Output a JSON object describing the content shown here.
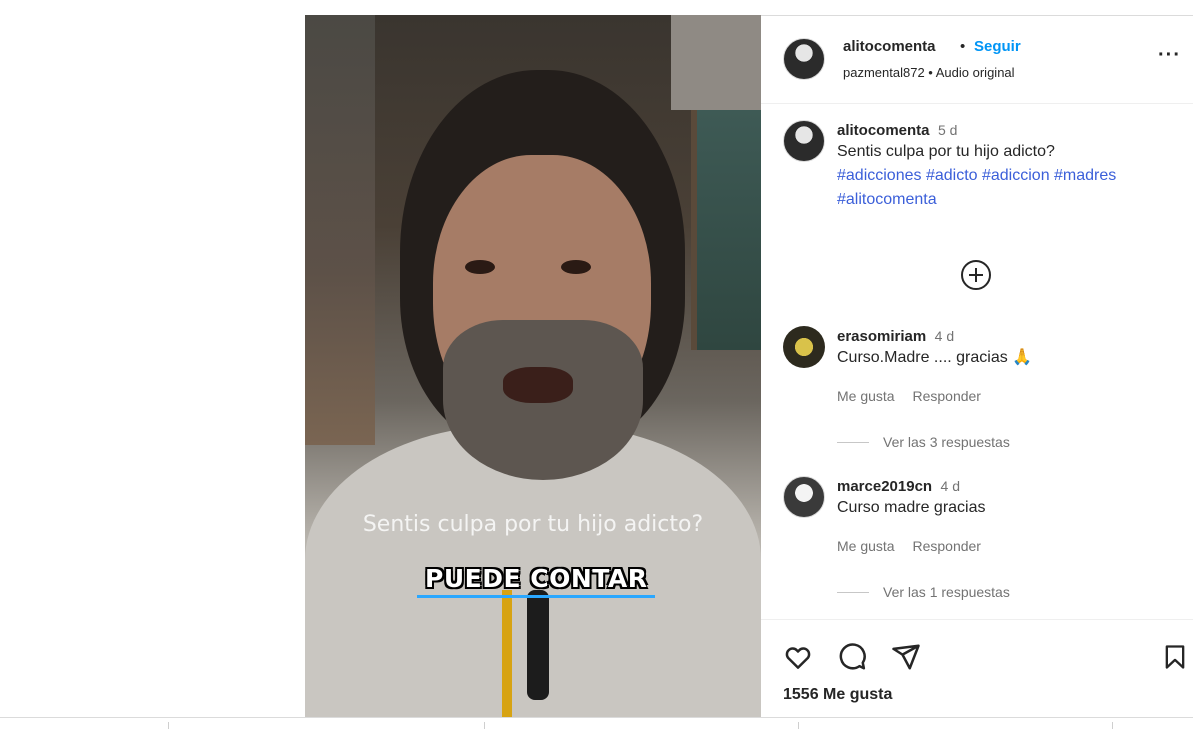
{
  "video": {
    "subtitle_text": "Sentis culpa por tu hijo adicto?",
    "caption_text": "PUEDE CONTAR"
  },
  "header": {
    "username": "alitocomenta",
    "dot": "•",
    "follow_label": "Seguir",
    "sub_user": "pazmental872",
    "sub_audio": "Audio original",
    "more_label": "···"
  },
  "caption_post": {
    "username": "alitocomenta",
    "time": "5 d",
    "text": "Sentis culpa por tu hijo adicto?",
    "hashtags_line1": "#adicciones #adicto #adiccion #madres",
    "hashtags_line2": "#alitocomenta"
  },
  "comments": [
    {
      "username": "erasomiriam",
      "time": "4 d",
      "text": "Curso.Madre .... gracias 🙏",
      "like_label": "Me gusta",
      "reply_label": "Responder",
      "view_replies": "Ver las 3 respuestas"
    },
    {
      "username": "marce2019cn",
      "time": "4 d",
      "text": "Curso madre gracias",
      "like_label": "Me gusta",
      "reply_label": "Responder",
      "view_replies": "Ver las 1 respuestas"
    }
  ],
  "footer": {
    "likes_text": "1556 Me gusta"
  },
  "icons": [
    "heart-icon",
    "comment-icon",
    "share-icon",
    "bookmark-icon",
    "plus-circle-icon",
    "more-icon"
  ],
  "colors": {
    "accent": "#0095f6",
    "hashtag": "#3b5fd9",
    "text": "#262626",
    "muted": "#737373"
  }
}
